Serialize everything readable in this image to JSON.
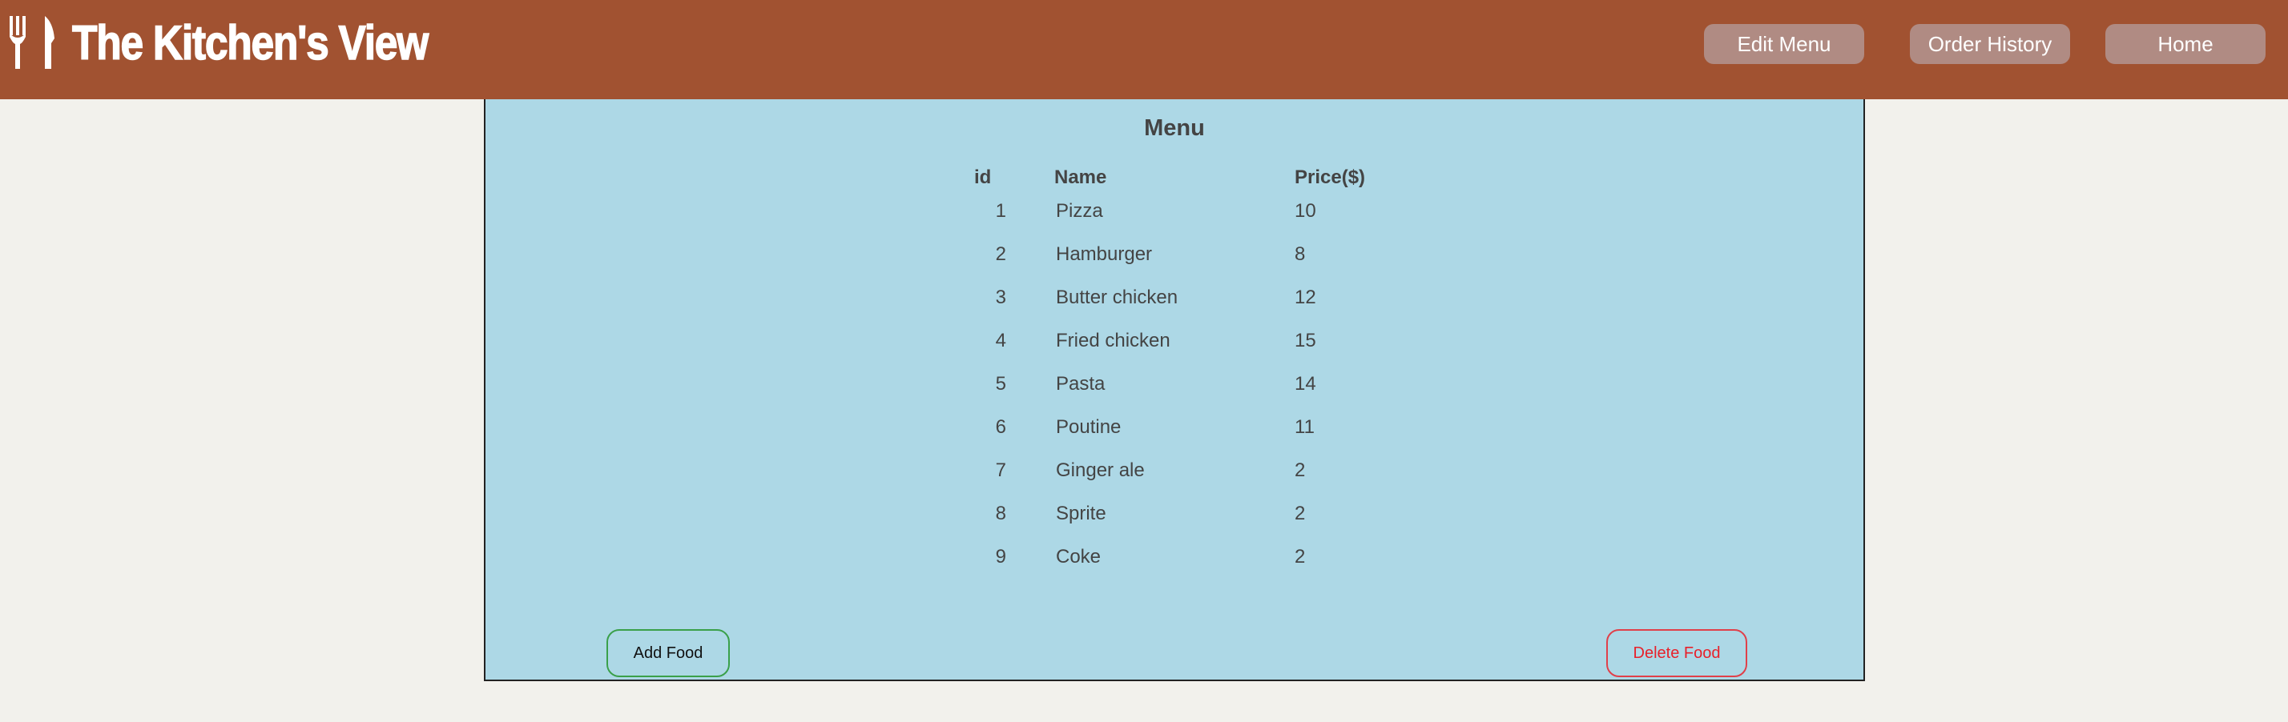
{
  "app": {
    "title": "The Kitchen's View",
    "logo_icon": "fork-knife-icon"
  },
  "nav": {
    "edit_menu": "Edit Menu",
    "order_history": "Order History",
    "home": "Home"
  },
  "menu": {
    "title": "Menu",
    "columns": [
      "id",
      "Name",
      "Price($)"
    ],
    "rows": [
      {
        "id": "1",
        "name": "Pizza",
        "price": "10"
      },
      {
        "id": "2",
        "name": "Hamburger",
        "price": "8"
      },
      {
        "id": "3",
        "name": "Butter chicken",
        "price": "12"
      },
      {
        "id": "4",
        "name": "Fried chicken",
        "price": "15"
      },
      {
        "id": "5",
        "name": "Pasta",
        "price": "14"
      },
      {
        "id": "6",
        "name": "Poutine",
        "price": "11"
      },
      {
        "id": "7",
        "name": "Ginger ale",
        "price": "2"
      },
      {
        "id": "8",
        "name": "Sprite",
        "price": "2"
      },
      {
        "id": "9",
        "name": "Coke",
        "price": "2"
      }
    ]
  },
  "actions": {
    "add_food": "Add Food",
    "delete_food": "Delete Food"
  },
  "colors": {
    "header_bg": "#a15231",
    "nav_button_bg": "#b08b83",
    "panel_bg": "#add8e6",
    "page_bg": "#f2f1ec",
    "add_border": "#3aa04a",
    "delete_text": "#e8202a"
  }
}
